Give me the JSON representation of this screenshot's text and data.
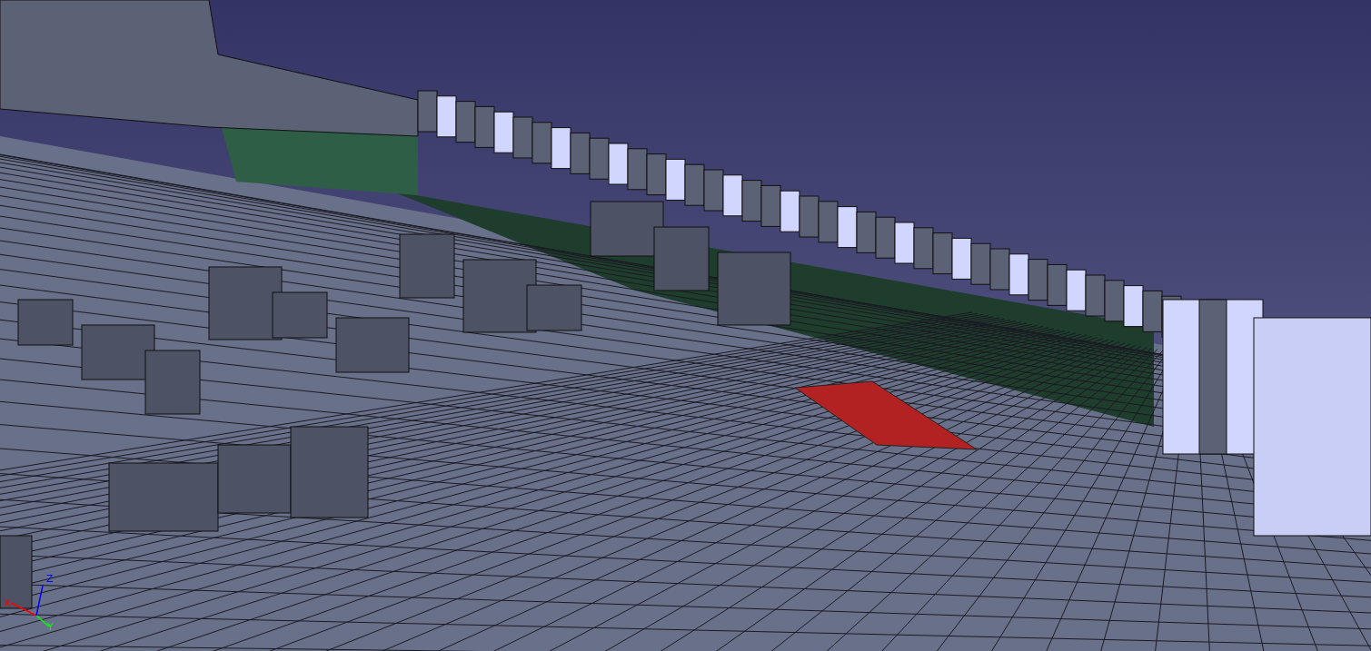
{
  "viewport": {
    "axes": [
      {
        "label": "X",
        "color": "#ff0000"
      },
      {
        "label": "Y",
        "color": "#00ff00"
      },
      {
        "label": "Z",
        "color": "#0000ff"
      }
    ]
  }
}
